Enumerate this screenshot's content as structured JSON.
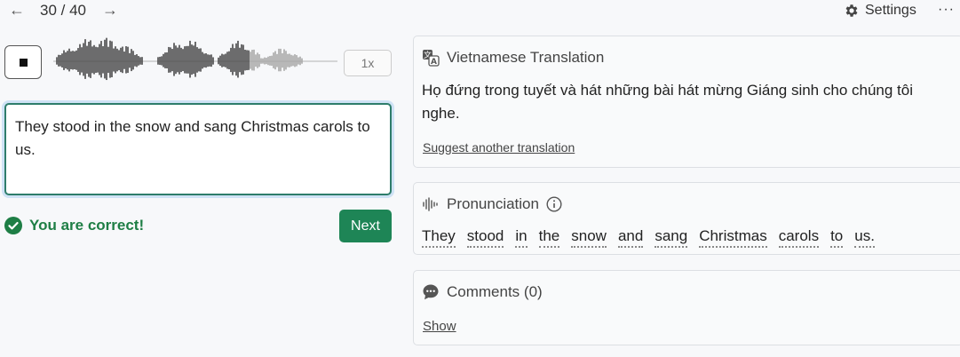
{
  "nav": {
    "prev_icon": "←",
    "next_icon": "→",
    "counter": "30 / 40",
    "settings_label": "Settings",
    "more_icon": "···"
  },
  "player": {
    "speed_label": "1x",
    "progress": 0.69
  },
  "answer": {
    "value": "They stood in the snow and sang Christmas carols to us."
  },
  "result": {
    "message": "You are correct!",
    "next_label": "Next"
  },
  "translation": {
    "title": "Vietnamese Translation",
    "text": "Họ đứng trong tuyết và hát những bài hát mừng Giáng sinh cho chúng tôi nghe.",
    "suggest_link": "Suggest another translation"
  },
  "pronunciation": {
    "title": "Pronunciation",
    "words": [
      "They",
      "stood",
      "in",
      "the",
      "snow",
      "and",
      "sang",
      "Christmas",
      "carols",
      "to",
      "us."
    ]
  },
  "comments": {
    "title": "Comments (0)",
    "show_link": "Show"
  },
  "colors": {
    "accent_green": "#1e8556",
    "success_text": "#1e7e45",
    "input_border": "#2e7d6b"
  }
}
